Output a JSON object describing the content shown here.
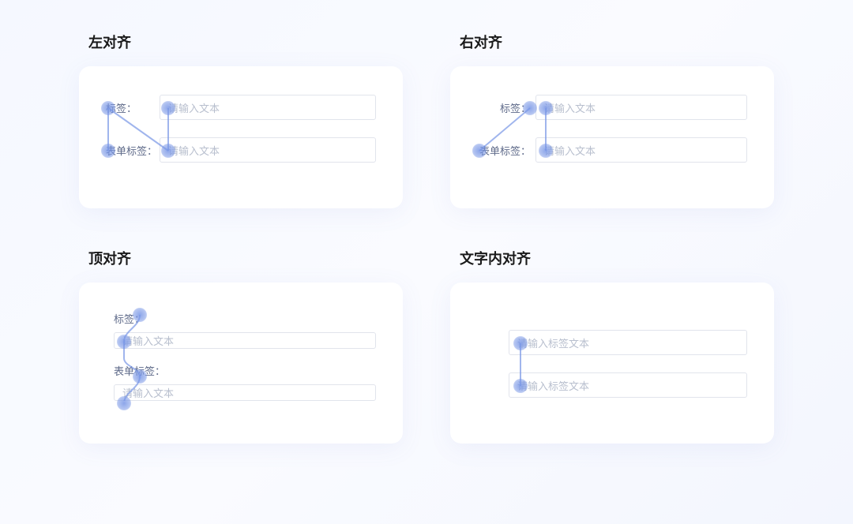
{
  "blocks": {
    "left_align": {
      "title": "左对齐",
      "row1": {
        "label": "标签：",
        "placeholder": "请输入文本"
      },
      "row2": {
        "label": "表单标签：",
        "placeholder": "请输入文本"
      }
    },
    "right_align": {
      "title": "右对齐",
      "row1": {
        "label": "标签：",
        "placeholder": "请输入文本"
      },
      "row2": {
        "label": "表单标签：",
        "placeholder": "请输入文本"
      }
    },
    "top_align": {
      "title": "顶对齐",
      "row1": {
        "label": "标签：",
        "placeholder": "请输入文本"
      },
      "row2": {
        "label": "表单标签：",
        "placeholder": "请输入文本"
      }
    },
    "inline_align": {
      "title": "文字内对齐",
      "row1": {
        "placeholder": "请输入标签文本"
      },
      "row2": {
        "placeholder": "请输入标签文本"
      }
    }
  }
}
